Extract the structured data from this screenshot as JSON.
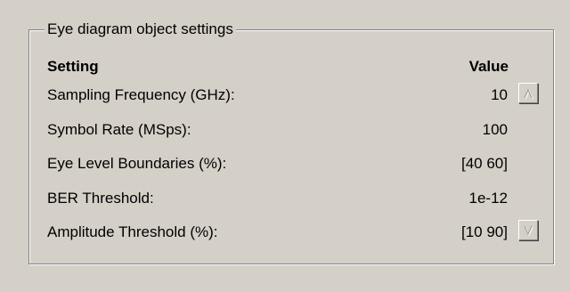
{
  "groupbox": {
    "title": "Eye diagram object settings"
  },
  "table": {
    "header_setting": "Setting",
    "header_value": "Value",
    "rows": [
      {
        "label": "Sampling Frequency (GHz):",
        "value": "10"
      },
      {
        "label": "Symbol Rate (MSps):",
        "value": "100"
      },
      {
        "label": "Eye Level Boundaries (%):",
        "value": "[40 60]"
      },
      {
        "label": "BER Threshold:",
        "value": "1e-12"
      },
      {
        "label": "Amplitude Threshold (%):",
        "value": "[10 90]"
      }
    ]
  },
  "buttons": {
    "scroll_up_icon": "caret-up-icon",
    "scroll_down_icon": "caret-down-icon"
  },
  "colors": {
    "background": "#d4d0c8",
    "shadow": "#808080",
    "highlight": "#ffffff",
    "disabled_glyph": "#a0a0a0"
  }
}
